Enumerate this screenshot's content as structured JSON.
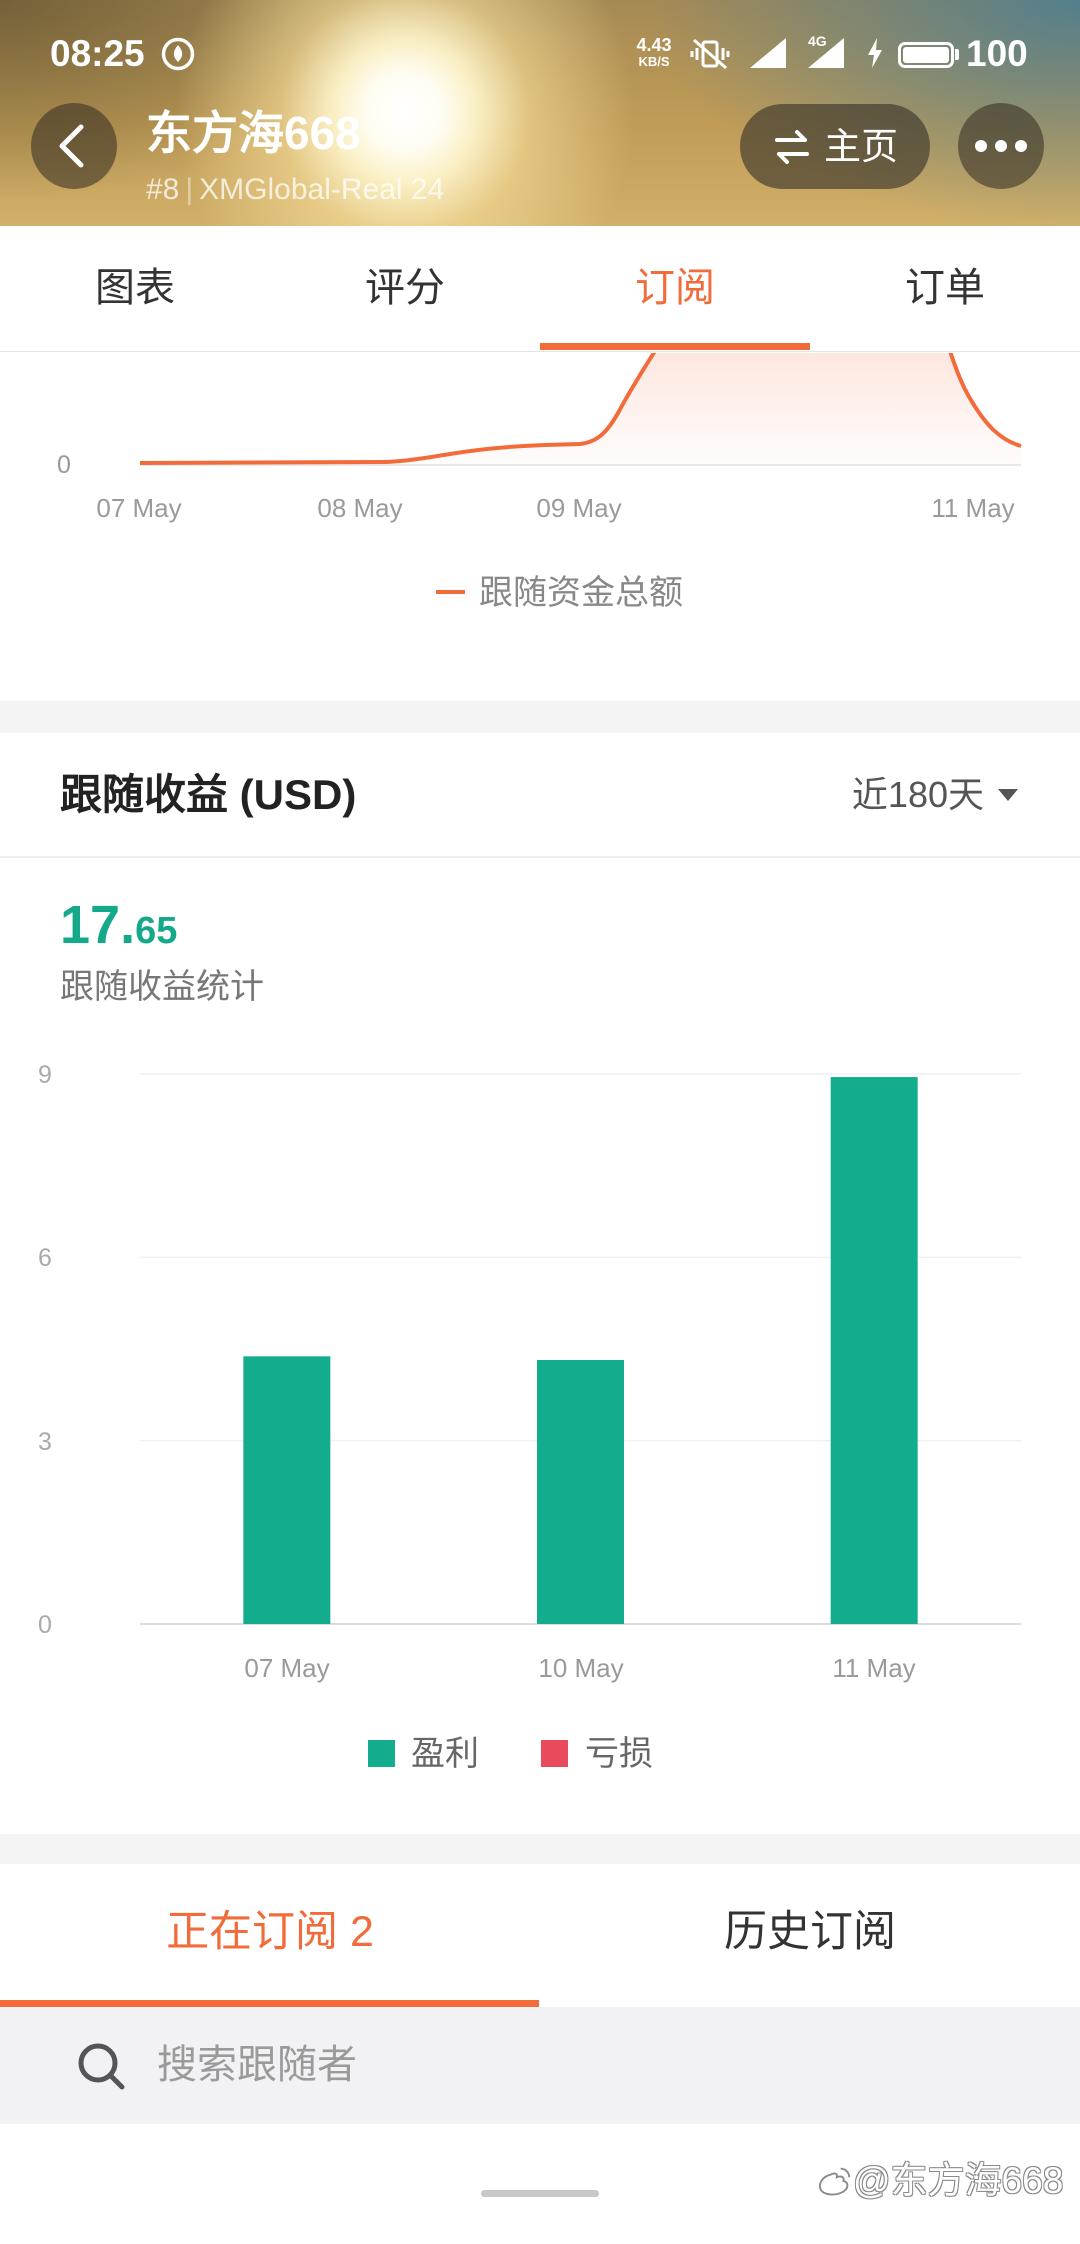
{
  "status_bar": {
    "time": "08:25",
    "net_speed": "4.43",
    "net_speed_unit": "KB/S",
    "network": "4G",
    "battery": "100",
    "icons": [
      "app-notification-icon",
      "vibrate-off-icon",
      "signal-icon",
      "4g-signal-icon",
      "charging-icon",
      "battery-icon"
    ]
  },
  "header": {
    "title": "东方海668",
    "rank": "#8",
    "divider": "|",
    "account": "XMGlobal-Real 24",
    "home_label": "主页",
    "icons": [
      "chevron-left-icon",
      "swap-icon",
      "more-icon"
    ]
  },
  "tabs": [
    {
      "label": "图表",
      "active": false
    },
    {
      "label": "评分",
      "active": false
    },
    {
      "label": "订阅",
      "active": true
    },
    {
      "label": "订单",
      "active": false
    }
  ],
  "earnings": {
    "title": "跟随收益 (USD)",
    "period": "近180天",
    "total_integer": "17.",
    "total_decimal": "65",
    "subtitle": "跟随收益统计"
  },
  "chart_data": [
    {
      "type": "line",
      "x_ticks": [
        "07 May",
        "08 May",
        "09 May",
        "11 May"
      ],
      "y_ticks": [
        0
      ],
      "series": [
        {
          "name": "跟随资金总额",
          "color": "#f26b3a"
        }
      ],
      "legend_position": "bottom"
    },
    {
      "type": "bar",
      "categories": [
        "07 May",
        "10 May",
        "11 May"
      ],
      "series": [
        {
          "name": "盈利",
          "values": [
            4.38,
            4.32,
            8.95
          ],
          "color": "#13ad8e"
        },
        {
          "name": "亏损",
          "values": [
            0,
            0,
            0
          ],
          "color": "#e94a5c"
        }
      ],
      "yticks": [
        0,
        3,
        6,
        9
      ],
      "ylim": [
        0,
        9
      ],
      "grid": true,
      "legend_position": "bottom"
    }
  ],
  "subscription_tabs": [
    {
      "label": "正在订阅 2",
      "active": true
    },
    {
      "label": "历史订阅",
      "active": false
    }
  ],
  "search": {
    "placeholder": "搜索跟随者",
    "value": "",
    "icon": "search-icon"
  },
  "watermark": "@东方海668",
  "colors": {
    "accent": "#f26b3a",
    "profit": "#13ad8e",
    "loss": "#e94a5c",
    "total": "#14a98b"
  }
}
